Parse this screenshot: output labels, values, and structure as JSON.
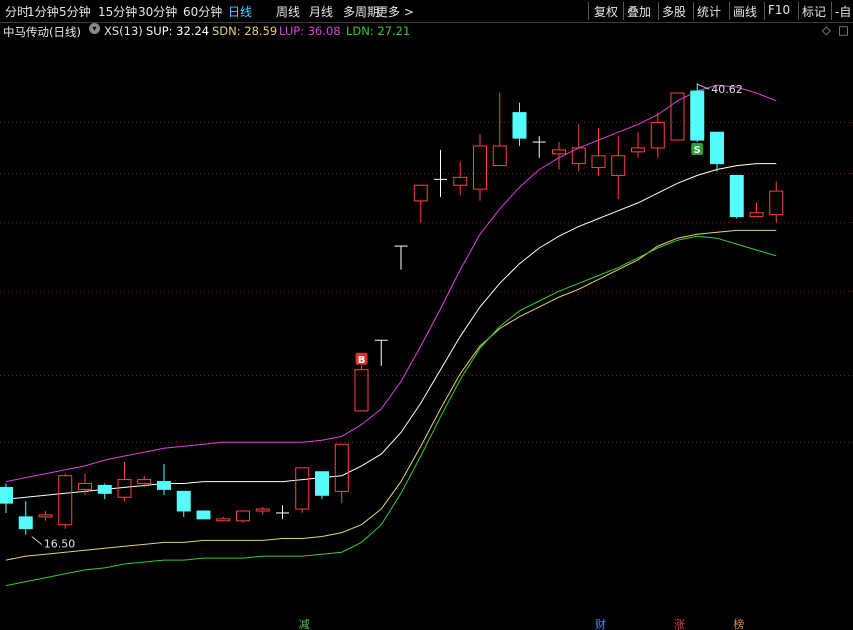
{
  "toolbar": {
    "left_items": [
      "分时",
      "1分钟",
      "5分钟",
      "15分钟",
      "30分钟",
      "60分钟",
      "日线",
      "周线",
      "月线",
      "多周期",
      "更多 >"
    ],
    "active": "日线",
    "right_items": [
      "复权",
      "叠加",
      "多股",
      "统计",
      "画线",
      "F10",
      "标记",
      "-自"
    ]
  },
  "legend": {
    "stock": "中马传动(日线)",
    "indicator": "XS(13)",
    "sup": "SUP: 32.24",
    "sdn": "SDN: 28.59",
    "lup": "LUP: 36.08",
    "ldn": "LDN: 27.21",
    "colors": {
      "sup": "#ffffff",
      "sdn": "#e8d17a",
      "lup": "#e040e0",
      "ldn": "#33cc33"
    }
  },
  "chart_data": {
    "type": "candlestick",
    "high_label": "40.62",
    "low_label": "16.50",
    "ylim": [
      13.5,
      42.8
    ],
    "candles": [
      {
        "o": 20.0,
        "c": 19.2,
        "h": 20.2,
        "l": 18.7
      },
      {
        "o": 18.5,
        "c": 17.9,
        "h": 19.3,
        "l": 17.6
      },
      {
        "o": 18.5,
        "c": 18.6,
        "h": 18.8,
        "l": 18.3
      },
      {
        "o": 18.1,
        "c": 20.6,
        "h": 20.7,
        "l": 17.9
      },
      {
        "o": 19.9,
        "c": 20.2,
        "h": 20.7,
        "l": 19.6
      },
      {
        "o": 20.1,
        "c": 19.7,
        "h": 20.2,
        "l": 19.4
      },
      {
        "o": 19.5,
        "c": 20.4,
        "h": 21.3,
        "l": 19.3
      },
      {
        "o": 20.2,
        "c": 20.4,
        "h": 20.6,
        "l": 20.0
      },
      {
        "o": 20.3,
        "c": 19.9,
        "h": 21.2,
        "l": 19.6
      },
      {
        "o": 19.8,
        "c": 18.8,
        "h": 19.8,
        "l": 18.5
      },
      {
        "o": 18.8,
        "c": 18.4,
        "h": 18.8,
        "l": 18.4
      },
      {
        "o": 18.3,
        "c": 18.4,
        "h": 18.5,
        "l": 18.3
      },
      {
        "o": 18.3,
        "c": 18.8,
        "h": 18.8,
        "l": 18.2
      },
      {
        "o": 18.8,
        "c": 18.9,
        "h": 19.0,
        "l": 18.6
      },
      {
        "o": 18.7,
        "c": 18.7,
        "h": 19.1,
        "l": 18.4
      },
      {
        "o": 18.9,
        "c": 21.0,
        "h": 21.0,
        "l": 18.7
      },
      {
        "o": 20.8,
        "c": 19.6,
        "h": 20.8,
        "l": 19.4
      },
      {
        "o": 19.8,
        "c": 22.2,
        "h": 22.2,
        "l": 19.2
      },
      {
        "o": 23.9,
        "c": 26.0,
        "h": 26.2,
        "l": 23.9
      },
      {
        "o": 27.5,
        "c": 27.5,
        "h": 27.5,
        "l": 26.2
      },
      {
        "o": 32.3,
        "c": 32.3,
        "h": 32.3,
        "l": 31.1
      },
      {
        "o": 34.6,
        "c": 35.4,
        "h": 35.4,
        "l": 33.5
      },
      {
        "o": 35.7,
        "c": 35.7,
        "h": 37.2,
        "l": 34.8
      },
      {
        "o": 35.4,
        "c": 35.8,
        "h": 36.6,
        "l": 34.9
      },
      {
        "o": 35.2,
        "c": 37.4,
        "h": 38.0,
        "l": 34.6
      },
      {
        "o": 36.4,
        "c": 37.4,
        "h": 40.1,
        "l": 36.4
      },
      {
        "o": 39.1,
        "c": 37.8,
        "h": 39.6,
        "l": 37.4
      },
      {
        "o": 37.6,
        "c": 37.6,
        "h": 37.9,
        "l": 36.8
      },
      {
        "o": 37.0,
        "c": 37.2,
        "h": 37.6,
        "l": 36.2
      },
      {
        "o": 36.5,
        "c": 37.3,
        "h": 38.5,
        "l": 36.1
      },
      {
        "o": 36.3,
        "c": 36.9,
        "h": 38.3,
        "l": 35.9
      },
      {
        "o": 35.9,
        "c": 36.9,
        "h": 37.9,
        "l": 34.7
      },
      {
        "o": 37.1,
        "c": 37.3,
        "h": 38.1,
        "l": 36.8
      },
      {
        "o": 37.3,
        "c": 38.6,
        "h": 39.1,
        "l": 36.8
      },
      {
        "o": 37.7,
        "c": 40.1,
        "h": 40.1,
        "l": 37.7
      },
      {
        "o": 40.2,
        "c": 37.7,
        "h": 40.6,
        "l": 37.6
      },
      {
        "o": 38.1,
        "c": 36.5,
        "h": 38.1,
        "l": 36.1
      },
      {
        "o": 35.9,
        "c": 33.8,
        "h": 35.9,
        "l": 33.7
      },
      {
        "o": 33.8,
        "c": 34.0,
        "h": 34.5,
        "l": 33.8
      },
      {
        "o": 33.9,
        "c": 35.1,
        "h": 35.6,
        "l": 33.5
      }
    ],
    "lines": [
      {
        "name": "LUP",
        "color": "#e040e0",
        "values": [
          20.3,
          20.5,
          20.7,
          20.9,
          21.1,
          21.4,
          21.6,
          21.8,
          22.0,
          22.1,
          22.2,
          22.3,
          22.3,
          22.3,
          22.3,
          22.3,
          22.4,
          22.6,
          23.2,
          24.0,
          25.4,
          27.2,
          29.1,
          31.1,
          32.9,
          34.2,
          35.3,
          36.2,
          36.8,
          37.3,
          37.7,
          38.1,
          38.5,
          39.0,
          39.7,
          40.2,
          40.5,
          40.4,
          40.1,
          39.7
        ]
      },
      {
        "name": "SUP",
        "color": "#ffffff",
        "values": [
          19.4,
          19.5,
          19.6,
          19.7,
          19.8,
          19.9,
          20.0,
          20.1,
          20.2,
          20.2,
          20.3,
          20.3,
          20.3,
          20.3,
          20.3,
          20.4,
          20.5,
          20.6,
          21.1,
          21.7,
          22.8,
          24.3,
          26.0,
          27.7,
          29.2,
          30.4,
          31.4,
          32.2,
          32.8,
          33.3,
          33.7,
          34.1,
          34.5,
          35.0,
          35.5,
          35.9,
          36.2,
          36.4,
          36.5,
          36.5
        ]
      },
      {
        "name": "SDN",
        "color": "#e8d17a",
        "values": [
          16.3,
          16.5,
          16.6,
          16.7,
          16.8,
          16.9,
          17.0,
          17.1,
          17.2,
          17.2,
          17.3,
          17.3,
          17.3,
          17.3,
          17.4,
          17.4,
          17.5,
          17.7,
          18.1,
          18.9,
          20.3,
          22.1,
          24.0,
          25.8,
          27.2,
          28.1,
          28.7,
          29.2,
          29.7,
          30.1,
          30.6,
          31.1,
          31.6,
          32.3,
          32.7,
          32.9,
          33.0,
          33.1,
          33.1,
          33.1
        ]
      },
      {
        "name": "LDN",
        "color": "#33cc33",
        "values": [
          15.0,
          15.2,
          15.4,
          15.6,
          15.8,
          15.9,
          16.1,
          16.2,
          16.3,
          16.3,
          16.4,
          16.4,
          16.4,
          16.5,
          16.5,
          16.5,
          16.6,
          16.7,
          17.2,
          18.1,
          19.7,
          21.6,
          23.6,
          25.5,
          27.1,
          28.2,
          29.0,
          29.5,
          30.0,
          30.4,
          30.8,
          31.2,
          31.7,
          32.2,
          32.6,
          32.8,
          32.7,
          32.4,
          32.1,
          31.8
        ]
      }
    ],
    "signals": [
      {
        "text": "B",
        "index": 18,
        "color": "#e03030"
      },
      {
        "text": "S",
        "index": 35,
        "color": "#2e9e3a"
      }
    ],
    "bottom_markers": [
      {
        "text": "减",
        "index": 15,
        "color": "#4ec94e"
      },
      {
        "text": "财",
        "index": 30,
        "color": "#4a8cff"
      },
      {
        "text": "涨",
        "index": 34,
        "color": "#e04040"
      },
      {
        "text": "榜",
        "index": 37,
        "color": "#e08830"
      }
    ],
    "colors": {
      "up": "#ff4242",
      "down": "#54fcfc",
      "grid": "#8b1a1a"
    }
  }
}
